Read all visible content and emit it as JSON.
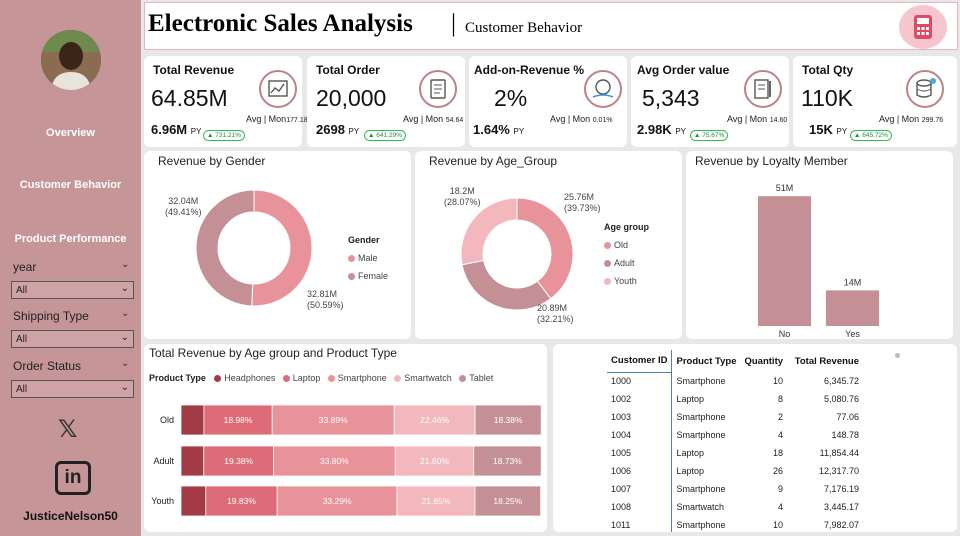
{
  "sidebar": {
    "nav": {
      "overview": "Overview",
      "customer_behavior": "Customer Behavior",
      "product_performance": "Product Performance"
    },
    "filters": [
      {
        "label": "year",
        "value": "All"
      },
      {
        "label": "Shipping Type",
        "value": "All"
      },
      {
        "label": "Order Status",
        "value": "All"
      }
    ],
    "x_logo": "𝕏",
    "linkedin_logo": "in",
    "handle": "JusticeNelson50"
  },
  "header": {
    "title": "Electronic Sales Analysis",
    "separator": "|",
    "subtitle": "Customer Behavior"
  },
  "kpis": [
    {
      "title": "Total Revenue",
      "value": "64.85M",
      "py_value": "6.96M",
      "py_label": "PY",
      "badge": "▲ 731.21%",
      "avg_label": "Avg | Mon",
      "avg_value": "177.18K"
    },
    {
      "title": "Total Order",
      "value": "20,000",
      "py_value": "2698",
      "py_label": "PY",
      "badge": "▲ 641.29%",
      "avg_label": "Avg | Mon",
      "avg_value": "54.64"
    },
    {
      "title": "Add-on-Revenue %",
      "value": "2%",
      "py_value": "1.64%",
      "py_label": "PY",
      "badge": "",
      "avg_label": "Avg | Mon",
      "avg_value": "0.01%"
    },
    {
      "title": "Avg Order value",
      "value": "5,343",
      "py_value": "2.98K",
      "py_label": "PY",
      "badge": "▲ 75.67%",
      "avg_label": "Avg | Mon",
      "avg_value": "14.60"
    },
    {
      "title": "Total Qty",
      "value": "110K",
      "py_value": "15K",
      "py_label": "PY",
      "badge": "▲ 645.72%",
      "avg_label": "Avg | Mon",
      "avg_value": "299.76"
    }
  ],
  "colors": {
    "sidebar": "#c59598",
    "male": "#e8939a",
    "female": "#c49095",
    "old": "#e8939a",
    "adult": "#c49095",
    "youth": "#f2b8bd",
    "bar": "#c49095"
  },
  "gender_chart": {
    "title": "Revenue by Gender",
    "legend_title": "Gender",
    "legend": [
      "Male",
      "Female"
    ],
    "female_label": "32.04M",
    "female_pct": "(49.41%)",
    "male_label": "32.81M",
    "male_pct": "(50.59%)"
  },
  "age_chart": {
    "title": "Revenue by Age_Group",
    "legend_title": "Age group",
    "legend": [
      "Old",
      "Adult",
      "Youth"
    ],
    "old_label": "25.76M",
    "old_pct": "(39.73%)",
    "adult_label": "20.89M",
    "adult_pct": "(32.21%)",
    "youth_label": "18.2M",
    "youth_pct": "(28.07%)"
  },
  "loyalty_chart": {
    "title": "Revenue by Loyalty Member"
  },
  "stacked_chart": {
    "title": "Total Revenue by Age group and Product Type",
    "legend_title": "Product Type",
    "legend": [
      "Headphones",
      "Laptop",
      "Smartphone",
      "Smartwatch",
      "Tablet"
    ]
  },
  "chart_data": [
    {
      "type": "pie",
      "title": "Revenue by Gender",
      "categories": [
        "Male",
        "Female"
      ],
      "values": [
        32.81,
        32.04
      ],
      "percent": [
        50.59,
        49.41
      ],
      "unit": "M"
    },
    {
      "type": "pie",
      "title": "Revenue by Age_Group",
      "categories": [
        "Old",
        "Adult",
        "Youth"
      ],
      "values": [
        25.76,
        20.89,
        18.2
      ],
      "percent": [
        39.73,
        32.21,
        28.07
      ],
      "unit": "M"
    },
    {
      "type": "bar",
      "title": "Revenue by Loyalty Member",
      "categories": [
        "No",
        "Yes"
      ],
      "values": [
        51,
        14
      ],
      "data_labels": [
        "51M",
        "14M"
      ],
      "ylim": [
        0,
        55
      ]
    },
    {
      "type": "bar",
      "stacked": true,
      "horizontal": true,
      "title": "Total Revenue by Age group and Product Type",
      "categories": [
        "Old",
        "Adult",
        "Youth"
      ],
      "series": [
        {
          "name": "Headphones",
          "values": [
            6.36,
            6.33,
            6.89
          ],
          "color": "#a33b47",
          "data_labels": [
            "",
            "",
            ""
          ]
        },
        {
          "name": "Laptop",
          "values": [
            18.98,
            19.38,
            19.83
          ],
          "color": "#dd6c78",
          "data_labels": [
            "18.98%",
            "19.38%",
            "19.83%"
          ]
        },
        {
          "name": "Smartphone",
          "values": [
            33.89,
            33.8,
            33.29
          ],
          "color": "#e8939a",
          "data_labels": [
            "33.89%",
            "33.80%",
            "33.29%"
          ]
        },
        {
          "name": "Smartwatch",
          "values": [
            22.46,
            21.8,
            21.65
          ],
          "color": "#f2b8bd",
          "data_labels": [
            "22.46%",
            "21.80%",
            "21.65%"
          ]
        },
        {
          "name": "Tablet",
          "values": [
            18.38,
            18.73,
            18.25
          ],
          "color": "#c49095",
          "data_labels": [
            "18.38%",
            "18.73%",
            "18.25%"
          ]
        }
      ],
      "xlim": [
        0,
        100
      ]
    }
  ],
  "table": {
    "columns": [
      "Customer ID",
      "Product Type",
      "Quantity",
      "Total Revenue"
    ],
    "rows": [
      [
        "1000",
        "Smartphone",
        "10",
        "6,345.72"
      ],
      [
        "1002",
        "Laptop",
        "8",
        "5,080.76"
      ],
      [
        "1003",
        "Smartphone",
        "2",
        "77.06"
      ],
      [
        "1004",
        "Smartphone",
        "4",
        "148.78"
      ],
      [
        "1005",
        "Laptop",
        "18",
        "11,854.44"
      ],
      [
        "1006",
        "Laptop",
        "26",
        "12,317.70"
      ],
      [
        "1007",
        "Smartphone",
        "9",
        "7,176.19"
      ],
      [
        "1008",
        "Smartwatch",
        "4",
        "3,445.17"
      ],
      [
        "1011",
        "Smartphone",
        "10",
        "7,982.07"
      ]
    ]
  }
}
